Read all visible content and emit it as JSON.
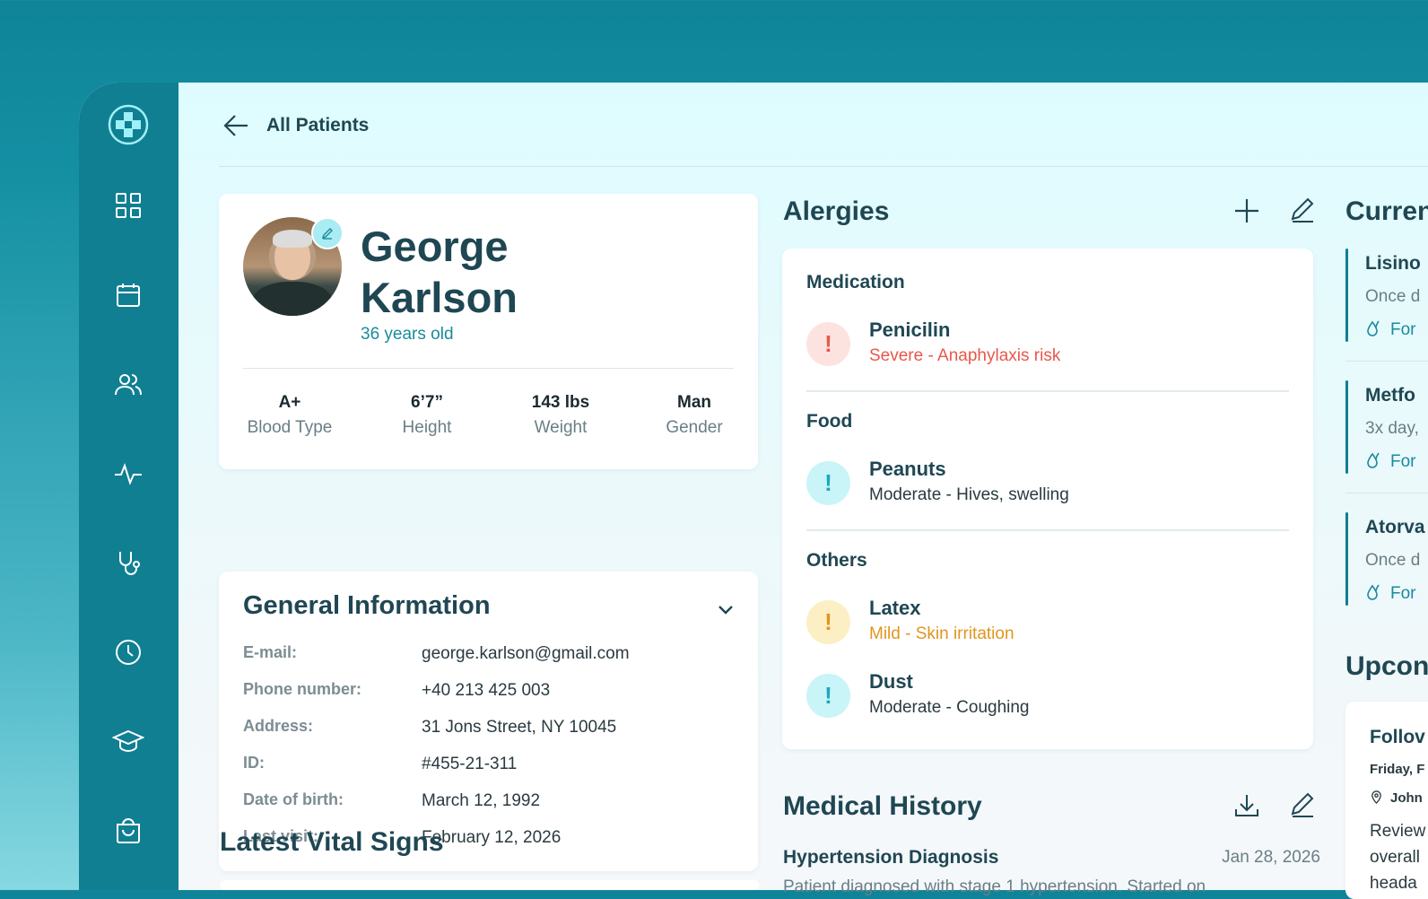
{
  "nav": {
    "back_label": "All Patients"
  },
  "sidebar": {
    "items": [
      {
        "name": "logo-icon"
      },
      {
        "name": "dashboard-icon"
      },
      {
        "name": "calendar-icon"
      },
      {
        "name": "patients-icon"
      },
      {
        "name": "activity-icon"
      },
      {
        "name": "stethoscope-icon"
      },
      {
        "name": "clock-icon"
      },
      {
        "name": "education-icon"
      },
      {
        "name": "shopping-bag-icon"
      }
    ]
  },
  "patient": {
    "first_name": "George",
    "last_name": "Karlson",
    "age": "36 years old",
    "stats": [
      {
        "value": "A+",
        "label": "Blood Type"
      },
      {
        "value": "6’7”",
        "label": "Height"
      },
      {
        "value": "143 lbs",
        "label": "Weight"
      },
      {
        "value": "Man",
        "label": "Gender"
      }
    ]
  },
  "general": {
    "title": "General Information",
    "rows": [
      {
        "key": "E-mail:",
        "value": "george.karlson@gmail.com"
      },
      {
        "key": "Phone number:",
        "value": "+40 213 425 003"
      },
      {
        "key": "Address:",
        "value": "31 Jons Street, NY 10045"
      },
      {
        "key": "ID:",
        "value": "#455-21-311"
      },
      {
        "key": "Date of birth:",
        "value": "March 12, 1992"
      },
      {
        "key": "Last visit:",
        "value": "February 12, 2026"
      }
    ]
  },
  "vitals": {
    "title": "Latest Vital Signs"
  },
  "allergies": {
    "title": "Alergies",
    "categories": [
      {
        "name": "Medication",
        "items": [
          {
            "name": "Penicilin",
            "desc": "Severe - Anaphylaxis risk",
            "severity": "severe"
          }
        ]
      },
      {
        "name": "Food",
        "items": [
          {
            "name": "Peanuts",
            "desc": "Moderate - Hives, swelling",
            "severity": "moderate"
          }
        ]
      },
      {
        "name": "Others",
        "items": [
          {
            "name": "Latex",
            "desc": "Mild - Skin irritation",
            "severity": "mild"
          },
          {
            "name": "Dust",
            "desc": "Moderate - Coughing",
            "severity": "moderate"
          }
        ]
      }
    ],
    "badge_symbol": "!",
    "colors": {
      "severe": "#e8584a",
      "moderate": "#1aa9bd",
      "mild": "#e0951e"
    }
  },
  "medical_history": {
    "title": "Medical History",
    "entries": [
      {
        "title": "Hypertension Diagnosis",
        "date": "Jan 28, 2026",
        "desc": "Patient diagnosed with stage 1 hypertension. Started on"
      }
    ]
  },
  "medications": {
    "title": "Curren",
    "items": [
      {
        "name": "Lisino",
        "freq": "Once d",
        "for": "For"
      },
      {
        "name": "Metfo",
        "freq": "3x day,",
        "for": "For"
      },
      {
        "name": "Atorva",
        "freq": "Once d",
        "for": "For"
      }
    ]
  },
  "upcoming": {
    "title": "Upcon",
    "card": {
      "title": "Follov",
      "date": "Friday, F",
      "location": "John",
      "desc1": "Review",
      "desc2": "overall",
      "desc3": "heada"
    }
  },
  "colors": {
    "primary": "#107f92",
    "accent": "#1a8b9d",
    "text": "#1f4753"
  }
}
